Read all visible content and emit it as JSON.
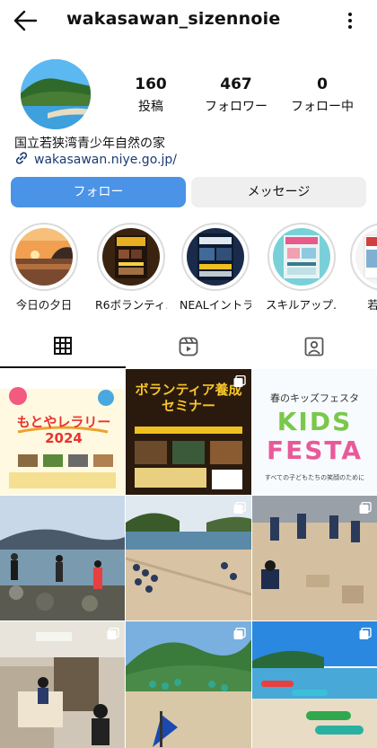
{
  "header": {
    "username": "wakasawan_sizennoie",
    "back_icon": "arrow-left-icon",
    "more_icon": "more-vertical-icon"
  },
  "profile": {
    "posts_count": "160",
    "posts_label": "投稿",
    "followers_count": "467",
    "followers_label": "フォロワー",
    "following_count": "0",
    "following_label": "フォロー中",
    "bio_name": "国立若狭湾青少年自然の家",
    "link": "wakasawan.niye.go.jp/"
  },
  "buttons": {
    "follow": "フォロー",
    "message": "メッセージ"
  },
  "highlights": [
    {
      "label": "今日の夕日"
    },
    {
      "label": "R6ボランティ..."
    },
    {
      "label": "NEALイントラ"
    },
    {
      "label": "スキルアップ..."
    },
    {
      "label": "若狭湾"
    }
  ],
  "tabs": {
    "grid_icon": "grid-icon",
    "reels_icon": "reels-icon",
    "tagged_icon": "tagged-icon"
  },
  "posts": [
    {
      "kind": "poster",
      "text": "もとやレラリー 2024"
    },
    {
      "kind": "poster",
      "text": "ボランティア養成セミナー"
    },
    {
      "kind": "poster",
      "title": "春のキッズフェスタ",
      "big1": "KIDS",
      "big2": "FESTA",
      "sub": "すべての子どもたちの笑顔のために"
    },
    {
      "kind": "photo"
    },
    {
      "kind": "photo"
    },
    {
      "kind": "photo"
    },
    {
      "kind": "photo"
    },
    {
      "kind": "photo"
    },
    {
      "kind": "photo"
    }
  ],
  "colors": {
    "follow_button": "#4b93e6",
    "message_button": "#efefef",
    "link": "#1a3c75"
  }
}
